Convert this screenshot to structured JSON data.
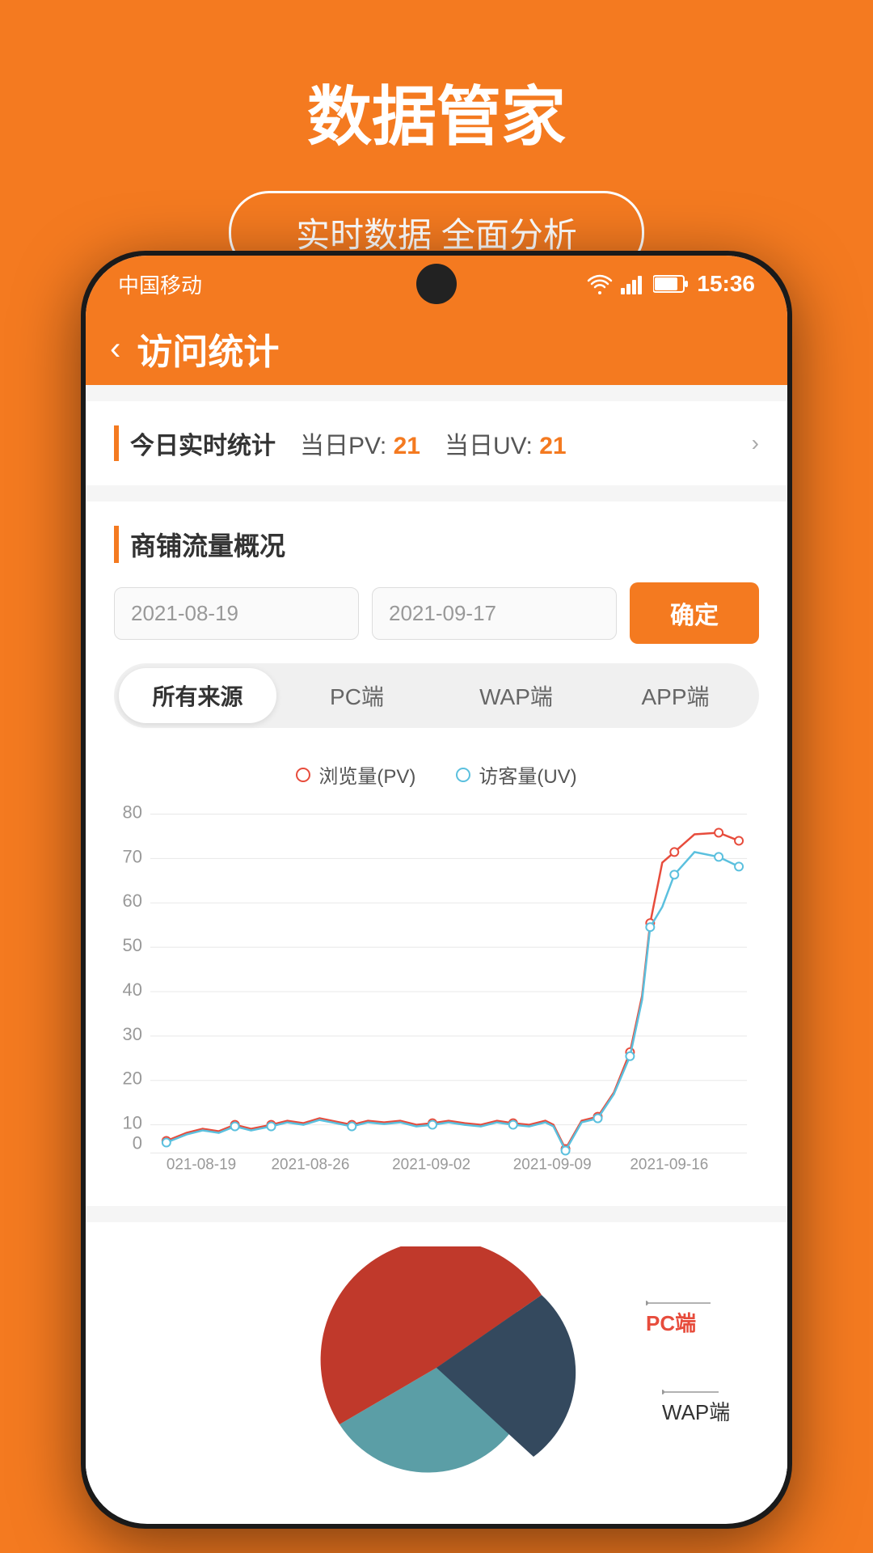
{
  "background_color": "#F47A20",
  "header": {
    "title": "数据管家",
    "subtitle": "实时数据 全面分析"
  },
  "status_bar": {
    "carrier": "中国移动",
    "time": "15:36",
    "wifi_icon": "wifi",
    "signal_icon": "signal",
    "battery_icon": "battery"
  },
  "nav": {
    "back_label": "‹",
    "title": "访问统计"
  },
  "today_stats": {
    "label": "今日实时统计",
    "pv_label": "当日PV:",
    "pv_value": "21",
    "uv_label": "当日UV:",
    "uv_value": "21"
  },
  "traffic_section": {
    "title": "商铺流量概况",
    "date_start": "2021-08-19",
    "date_end": "2021-09-17",
    "confirm_label": "确定"
  },
  "tabs": [
    {
      "label": "所有来源",
      "active": true
    },
    {
      "label": "PC端",
      "active": false
    },
    {
      "label": "WAP端",
      "active": false
    },
    {
      "label": "APP端",
      "active": false
    }
  ],
  "chart": {
    "legend_pv": "浏览量(PV)",
    "legend_uv": "访客量(UV)",
    "x_labels": [
      "021-08-19",
      "2021-08-26",
      "2021-09-02",
      "2021-09-09",
      "2021-09-16"
    ],
    "y_labels": [
      "0",
      "10",
      "20",
      "30",
      "40",
      "50",
      "60",
      "70",
      "80"
    ],
    "pv_color": "#e74c3c",
    "uv_color": "#5bc0de"
  },
  "pie_chart": {
    "pc_label": "PC端",
    "wap_label": "WAP端",
    "pc_color": "#e74c3c",
    "wap_color": "#34495e",
    "teal_color": "#5b9ea6"
  }
}
